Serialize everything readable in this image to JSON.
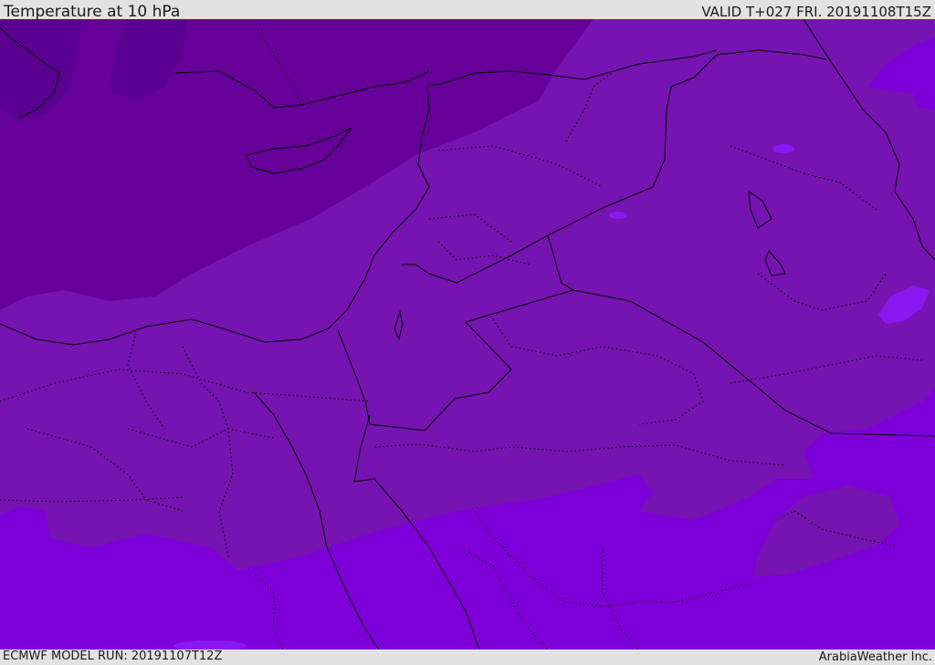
{
  "header": {
    "title": "Temperature at 10 hPa",
    "valid_time": "VALID T+027 FRI. 20191108T15Z"
  },
  "footer": {
    "model_run": "ECMWF MODEL RUN: 20191107T12Z",
    "credit": "ArabiaWeather Inc."
  },
  "map": {
    "variable": "temperature",
    "pressure_level_hpa": 10,
    "colors": {
      "coldest_band": "#5a0090",
      "cold_band": "#660099",
      "mid_band": "#7514b0",
      "warm_band": "#7e00d8",
      "warmest_spots": "#8a18f0",
      "border_line": "#000000"
    }
  }
}
